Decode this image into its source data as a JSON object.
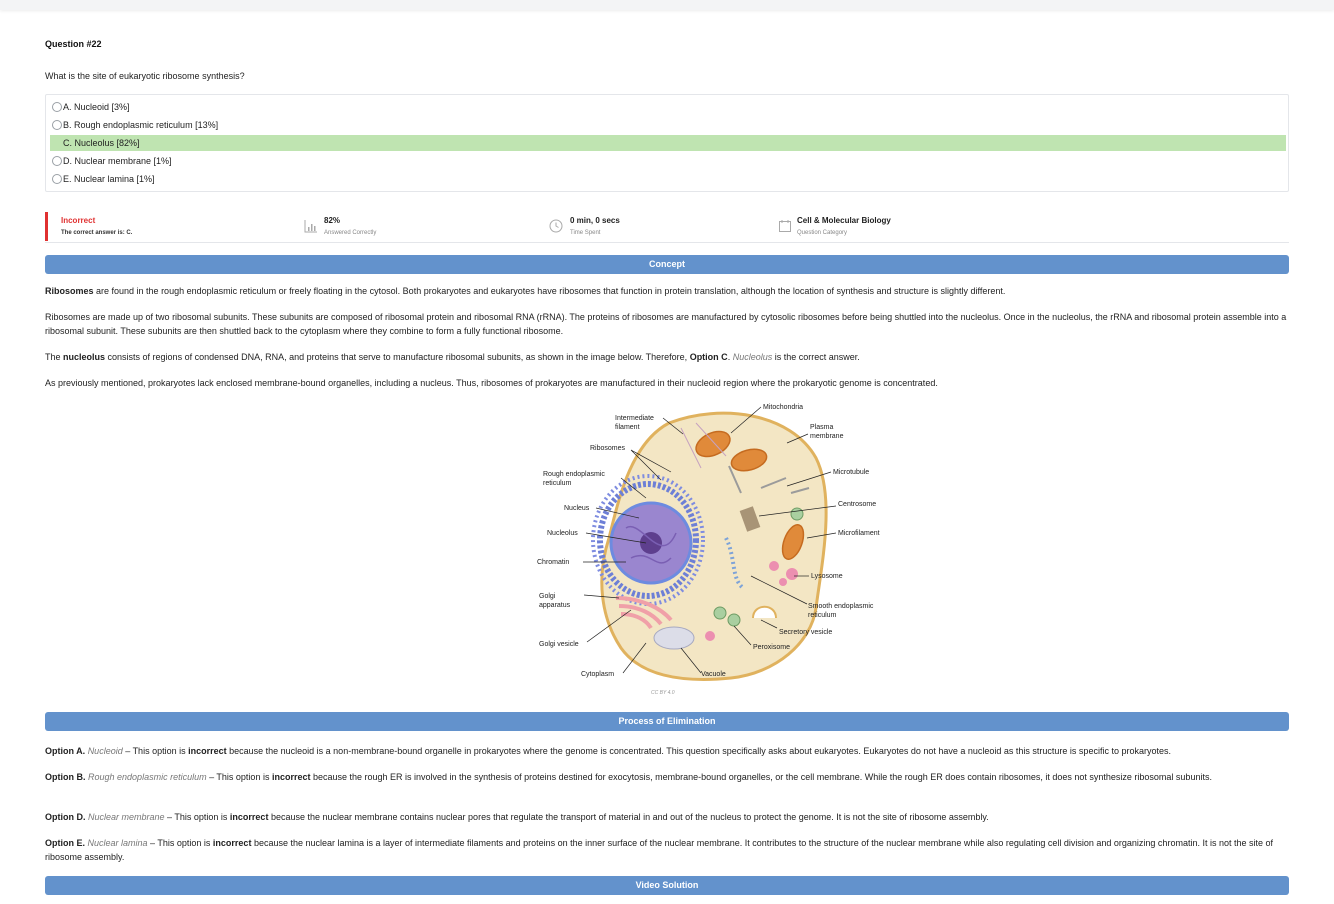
{
  "question": {
    "number": "Question #22",
    "text": "What is the site of eukaryotic ribosome synthesis?",
    "options": [
      {
        "label": "A. Nucleoid [3%]"
      },
      {
        "label": "B. Rough endoplasmic reticulum [13%]"
      },
      {
        "label": "C. Nucleolus [82%]"
      },
      {
        "label": "D. Nuclear membrane [1%]"
      },
      {
        "label": "E. Nuclear lamina [1%]"
      }
    ],
    "correct_color": "#bfe4b1"
  },
  "stats": {
    "result": "Incorrect",
    "result_sub": "The correct answer is: C.",
    "result_color": "#e03131",
    "percent": "82%",
    "percent_sub": "Answered Correctly",
    "time": "0 min, 0 secs",
    "time_sub": "Time Spent",
    "category": "Cell & Molecular Biology",
    "category_sub": "Question Category",
    "icons": [
      "bar-chart-icon",
      "clock-icon",
      "calendar-icon"
    ]
  },
  "concept": {
    "heading": "Concept",
    "p1_bold": "Ribosomes",
    "p1_rest": " are found in the rough endoplasmic reticulum or freely floating in the cytosol. Both prokaryotes and eukaryotes have ribosomes that function in protein translation, although the location of synthesis and structure is slightly different.",
    "p2": "Ribosomes are made up of two ribosomal subunits. These subunits are composed of ribosomal protein and ribosomal RNA (rRNA). The proteins of ribosomes are manufactured by cytosolic ribosomes before being shuttled into the nucleolus. Once in the nucleolus, the rRNA and ribosomal protein assemble into a ribosomal subunit. These subunits are then shuttled back to the cytoplasm where they combine to form a fully functional ribosome.",
    "p3_a": "The ",
    "p3_bold": "nucleolus",
    "p3_b": " consists of regions of condensed DNA, RNA, and proteins that serve to manufacture ribosomal subunits, as shown in the image below. Therefore, ",
    "p3_option": "Option C",
    "p3_c": ". ",
    "p3_italic": "Nucleolus",
    "p3_d": " is the correct answer.",
    "p4": "As previously mentioned, prokaryotes lack enclosed membrane-bound organelles, including a nucleus. Thus, ribosomes of prokaryotes are manufactured in their nucleoid region where the prokaryotic genome is concentrated."
  },
  "figure": {
    "credit": "CC BY 4.0",
    "labels": {
      "mitochondria": "Mitochondria",
      "intermediate_1": "Intermediate",
      "intermediate_2": "filament",
      "plasma_1": "Plasma",
      "plasma_2": "membrane",
      "ribosomes": "Ribosomes",
      "rough_er_1": "Rough endoplasmic",
      "rough_er_2": "reticulum",
      "microtubule": "Microtubule",
      "nucleus": "Nucleus",
      "centrosome": "Centrosome",
      "nucleolus": "Nucleolus",
      "microfilament": "Microfilament",
      "chromatin": "Chromatin",
      "lysosome": "Lysosome",
      "golgi_1": "Golgi",
      "golgi_2": "apparatus",
      "smooth_er_1": "Smooth endoplasmic",
      "smooth_er_2": "reticulum",
      "secretory": "Secretory vesicle",
      "golgi_vesicle": "Golgi vesicle",
      "peroxisome": "Peroxisome",
      "cytoplasm": "Cytoplasm",
      "vacuole": "Vacuole"
    }
  },
  "elimination": {
    "heading": "Process of Elimination",
    "a_label": "Option A.",
    "a_italic": "Nucleoid",
    "a_pre": " – This option is ",
    "a_bold": "incorrect",
    "a_rest": " because the nucleoid is a non-membrane-bound organelle in prokaryotes where the genome is concentrated. This question specifically asks about eukaryotes. Eukaryotes do not have a nucleoid as this structure is specific to prokaryotes.",
    "b_label": "Option B.",
    "b_italic": "Rough endoplasmic reticulum",
    "b_pre": " – This option is ",
    "b_bold": "incorrect",
    "b_rest": " because the rough ER is involved in the synthesis of proteins destined for exocytosis, membrane-bound organelles, or the cell membrane. While the rough ER does contain ribosomes, it does not synthesize ribosomal subunits.",
    "d_label": "Option D.",
    "d_italic": "Nuclear membrane",
    "d_pre": " – This option is ",
    "d_bold": "incorrect",
    "d_rest": " because the nuclear membrane contains nuclear pores that regulate the transport of material in and out of the nucleus to protect the genome. It is not the site of ribosome assembly.",
    "e_label": "Option E.",
    "e_italic": "Nuclear lamina",
    "e_pre": " – This option is ",
    "e_bold": "incorrect",
    "e_rest": " because the nuclear lamina is a layer of intermediate filaments and proteins on the inner surface of the nuclear membrane. It contributes to the structure of the nuclear membrane while also regulating cell division and organizing chromatin. It is not the site of ribosome assembly."
  },
  "video": {
    "heading": "Video Solution"
  },
  "colors": {
    "banner": "#6392cc",
    "incorrect": "#e03131"
  }
}
